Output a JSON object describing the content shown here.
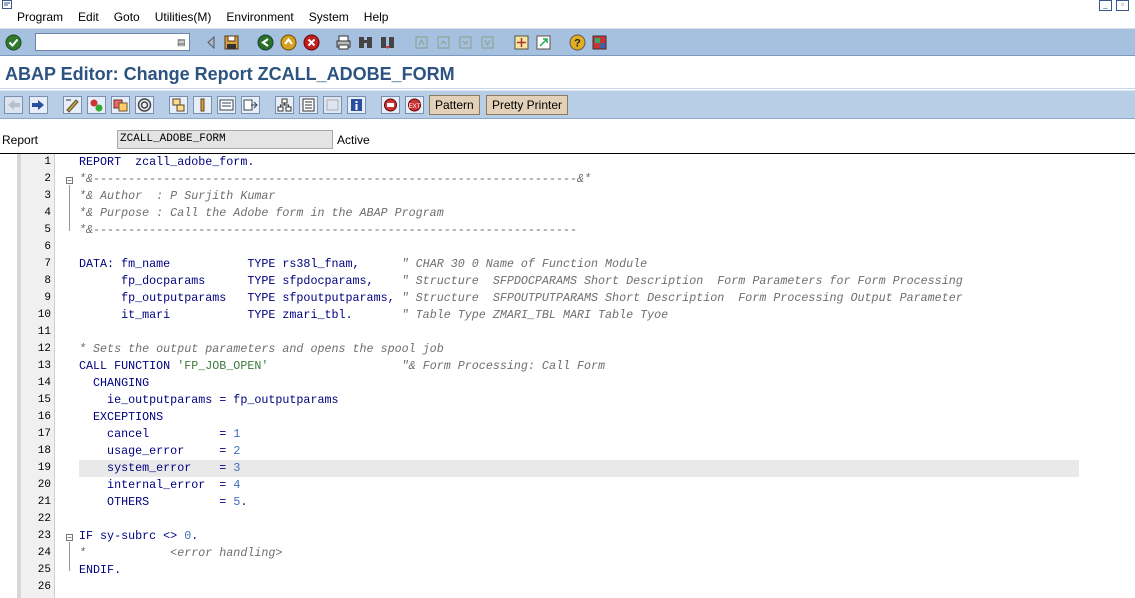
{
  "menu": {
    "items": [
      "Program",
      "Edit",
      "Goto",
      "Utilities(M)",
      "Environment",
      "System",
      "Help"
    ]
  },
  "command_field": {
    "value": ""
  },
  "title": "ABAP Editor: Change Report ZCALL_ADOBE_FORM",
  "app_toolbar": {
    "pattern_label": "Pattern",
    "pretty_printer_label": "Pretty Printer"
  },
  "report": {
    "label": "Report",
    "name": "ZCALL_ADOBE_FORM",
    "status": "Active"
  },
  "editor": {
    "current_line": 19,
    "lines": [
      {
        "n": "1",
        "t": "REPORT  zcall_adobe_form."
      },
      {
        "n": "2",
        "t": "*&---------------------------------------------------------------------&*"
      },
      {
        "n": "3",
        "t": "*& Author  : P Surjith Kumar"
      },
      {
        "n": "4",
        "t": "*& Purpose : Call the Adobe form in the ABAP Program"
      },
      {
        "n": "5",
        "t": "*&---------------------------------------------------------------------"
      },
      {
        "n": "6",
        "t": ""
      },
      {
        "n": "7",
        "t": "DATA: fm_name           TYPE rs38l_fnam,      \" CHAR 30 0 Name of Function Module"
      },
      {
        "n": "8",
        "t": "      fp_docparams      TYPE sfpdocparams,    \" Structure  SFPDOCPARAMS Short Description  Form Parameters for Form Processing"
      },
      {
        "n": "9",
        "t": "      fp_outputparams   TYPE sfpoutputparams, \" Structure  SFPOUTPUTPARAMS Short Description  Form Processing Output Parameter"
      },
      {
        "n": "10",
        "t": "      it_mari           TYPE zmari_tbl.       \" Table Type ZMARI_TBL MARI Table Tyoe"
      },
      {
        "n": "11",
        "t": ""
      },
      {
        "n": "12",
        "t": "* Sets the output parameters and opens the spool job"
      },
      {
        "n": "13",
        "t": "CALL FUNCTION 'FP_JOB_OPEN'                   \"& Form Processing: Call Form"
      },
      {
        "n": "14",
        "t": "  CHANGING"
      },
      {
        "n": "15",
        "t": "    ie_outputparams = fp_outputparams"
      },
      {
        "n": "16",
        "t": "  EXCEPTIONS"
      },
      {
        "n": "17",
        "t": "    cancel          = 1"
      },
      {
        "n": "18",
        "t": "    usage_error     = 2"
      },
      {
        "n": "19",
        "t": "    system_error    = 3"
      },
      {
        "n": "20",
        "t": "    internal_error  = 4"
      },
      {
        "n": "21",
        "t": "    OTHERS          = 5."
      },
      {
        "n": "22",
        "t": ""
      },
      {
        "n": "23",
        "t": "IF sy-subrc <> 0."
      },
      {
        "n": "24",
        "t": "*            <error handling>"
      },
      {
        "n": "25",
        "t": "ENDIF."
      },
      {
        "n": "26",
        "t": ""
      }
    ]
  }
}
